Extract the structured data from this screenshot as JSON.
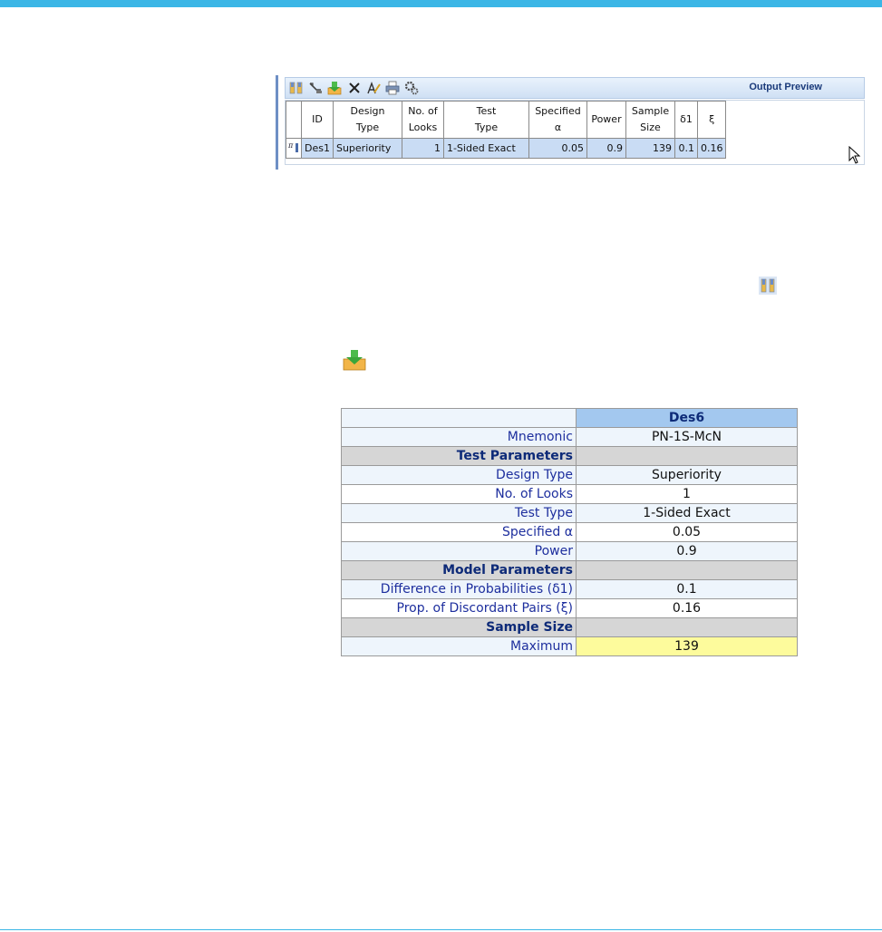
{
  "colors": {
    "top_bar": "#3bb6e6",
    "toolbar_title": "#1a3a7a",
    "summary_header": "#a3c8ef",
    "section_row": "#d6d6d6",
    "label_text": "#1e2f9e",
    "highlight": "#fdfb9c",
    "selected_row": "#c9dcf4"
  },
  "output_preview": {
    "title": "Output Preview",
    "toolbar_icons": [
      "design-details-icon",
      "edit-design-icon",
      "save-to-workbook-icon",
      "delete-icon",
      "rename-icon",
      "print-icon",
      "settings-icon"
    ],
    "columns": [
      {
        "line1": "ID",
        "line2": ""
      },
      {
        "line1": "Design",
        "line2": "Type"
      },
      {
        "line1": "No. of",
        "line2": "Looks"
      },
      {
        "line1": "Test",
        "line2": "Type"
      },
      {
        "line1": "Specified",
        "line2": "α"
      },
      {
        "line1": "Power",
        "line2": ""
      },
      {
        "line1": "Sample",
        "line2": "Size"
      },
      {
        "line1": "δ1",
        "line2": ""
      },
      {
        "line1": "ξ",
        "line2": ""
      }
    ],
    "row": {
      "id": "Des1",
      "design_type": "Superiority",
      "looks": "1",
      "test_type": "1-Sided Exact",
      "alpha": "0.05",
      "power": "0.9",
      "sample_size": "139",
      "delta1": "0.1",
      "xi": "0.16"
    }
  },
  "floating_icons": [
    "design-details-icon",
    "save-to-workbook-icon"
  ],
  "summary": {
    "column_header": "Des6",
    "mnemonic_label": "Mnemonic",
    "mnemonic_value": "PN-1S-McN",
    "test_parameters": "Test Parameters",
    "design_type_label": "Design Type",
    "design_type_value": "Superiority",
    "looks_label": "No. of Looks",
    "looks_value": "1",
    "test_type_label": "Test Type",
    "test_type_value": "1-Sided Exact",
    "alpha_label": "Specified α",
    "alpha_value": "0.05",
    "power_label": "Power",
    "power_value": "0.9",
    "model_parameters": "Model Parameters",
    "diff_label": "Difference in Probabilities (δ1)",
    "diff_value": "0.1",
    "discordant_label": "Prop. of Discordant Pairs (ξ)",
    "discordant_value": "0.16",
    "sample_size": "Sample Size",
    "maximum_label": "Maximum",
    "maximum_value": "139"
  }
}
